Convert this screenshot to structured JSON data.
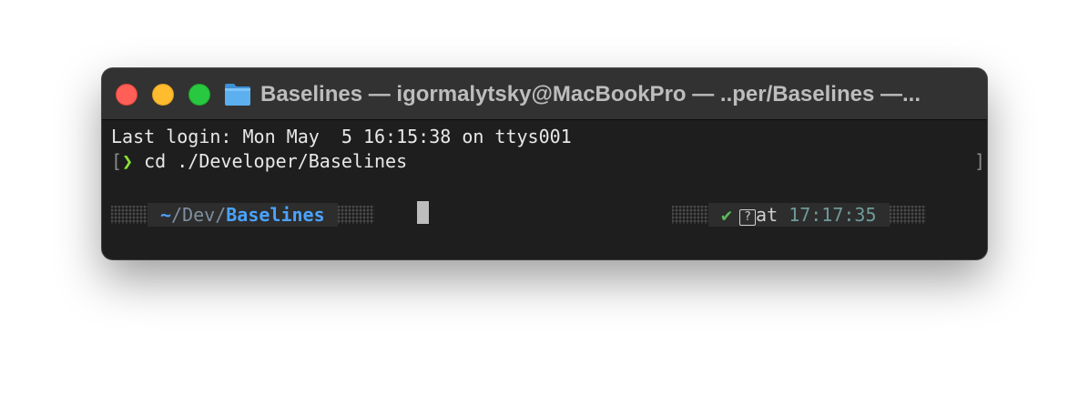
{
  "window": {
    "title": "Baselines — igormalytsky@MacBookPro — ..per/Baselines —...",
    "icons": [
      "close-button",
      "minimize-button",
      "zoom-button",
      "folder-icon"
    ]
  },
  "terminal": {
    "last_login": "Last login: Mon May  5 16:15:38 on ttys001",
    "prev_prompt": {
      "left_bracket": "[",
      "arrow": "❯",
      "command": " cd ./Developer/Baselines",
      "right_bracket": "]"
    },
    "prompt": {
      "dir_tilde": "~",
      "dir_mid": "/Dev/",
      "dir_last": "Baselines",
      "status_check": "✔",
      "status_icon": "?",
      "at_label": "at",
      "time": "17:17:35"
    }
  },
  "colors": {
    "background": "#1e1e1e",
    "titlebar": "#323232",
    "close": "#ff5f57",
    "minimize": "#febc2e",
    "zoom": "#28c840",
    "prompt_arrow": "#8ae234",
    "dir_accent": "#4aa3ff",
    "check": "#5cb85c",
    "time": "#6f9a9a"
  }
}
